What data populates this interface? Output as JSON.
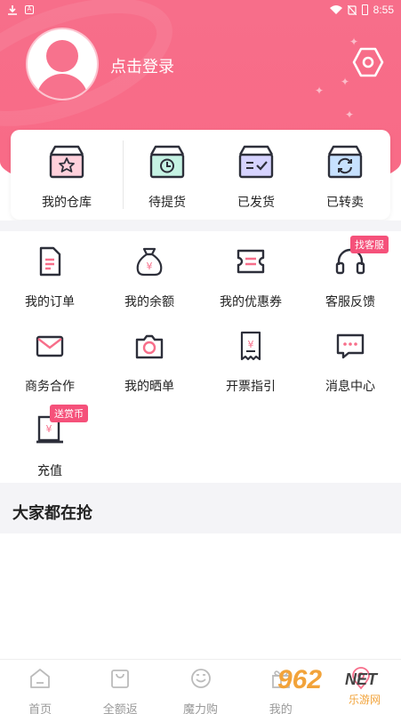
{
  "status_bar": {
    "time": "8:55"
  },
  "profile": {
    "login_label": "点击登录"
  },
  "orders": [
    {
      "label": "我的仓库",
      "icon": "warehouse-star-icon"
    },
    {
      "label": "待提货",
      "icon": "box-clock-icon"
    },
    {
      "label": "已发货",
      "icon": "box-shipped-icon"
    },
    {
      "label": "已转卖",
      "icon": "box-refresh-icon"
    }
  ],
  "tools": [
    {
      "label": "我的订单",
      "icon": "order-doc-icon"
    },
    {
      "label": "我的余额",
      "icon": "money-bag-icon"
    },
    {
      "label": "我的优惠券",
      "icon": "coupon-icon"
    },
    {
      "label": "客服反馈",
      "icon": "headset-icon",
      "badge": "找客服"
    },
    {
      "label": "商务合作",
      "icon": "mail-icon"
    },
    {
      "label": "我的晒单",
      "icon": "camera-icon"
    },
    {
      "label": "开票指引",
      "icon": "invoice-icon"
    },
    {
      "label": "消息中心",
      "icon": "message-icon"
    },
    {
      "label": "充值",
      "icon": "recharge-icon",
      "badge": "送赏币"
    }
  ],
  "section": {
    "title": "大家都在抢"
  },
  "nav": [
    {
      "label": "首页",
      "icon": "home-icon"
    },
    {
      "label": "全额返",
      "icon": "bag-icon"
    },
    {
      "label": "魔力购",
      "icon": "face-icon"
    },
    {
      "label": "我的",
      "icon": "gift-icon"
    },
    {
      "label": "",
      "icon": "location-icon"
    }
  ],
  "watermark": {
    "number": "962",
    "net": "NET",
    "sub": "乐游网"
  },
  "colors": {
    "accent": "#f76e8a",
    "badge": "#f5517a",
    "icon_dark": "#2d2f3a"
  }
}
